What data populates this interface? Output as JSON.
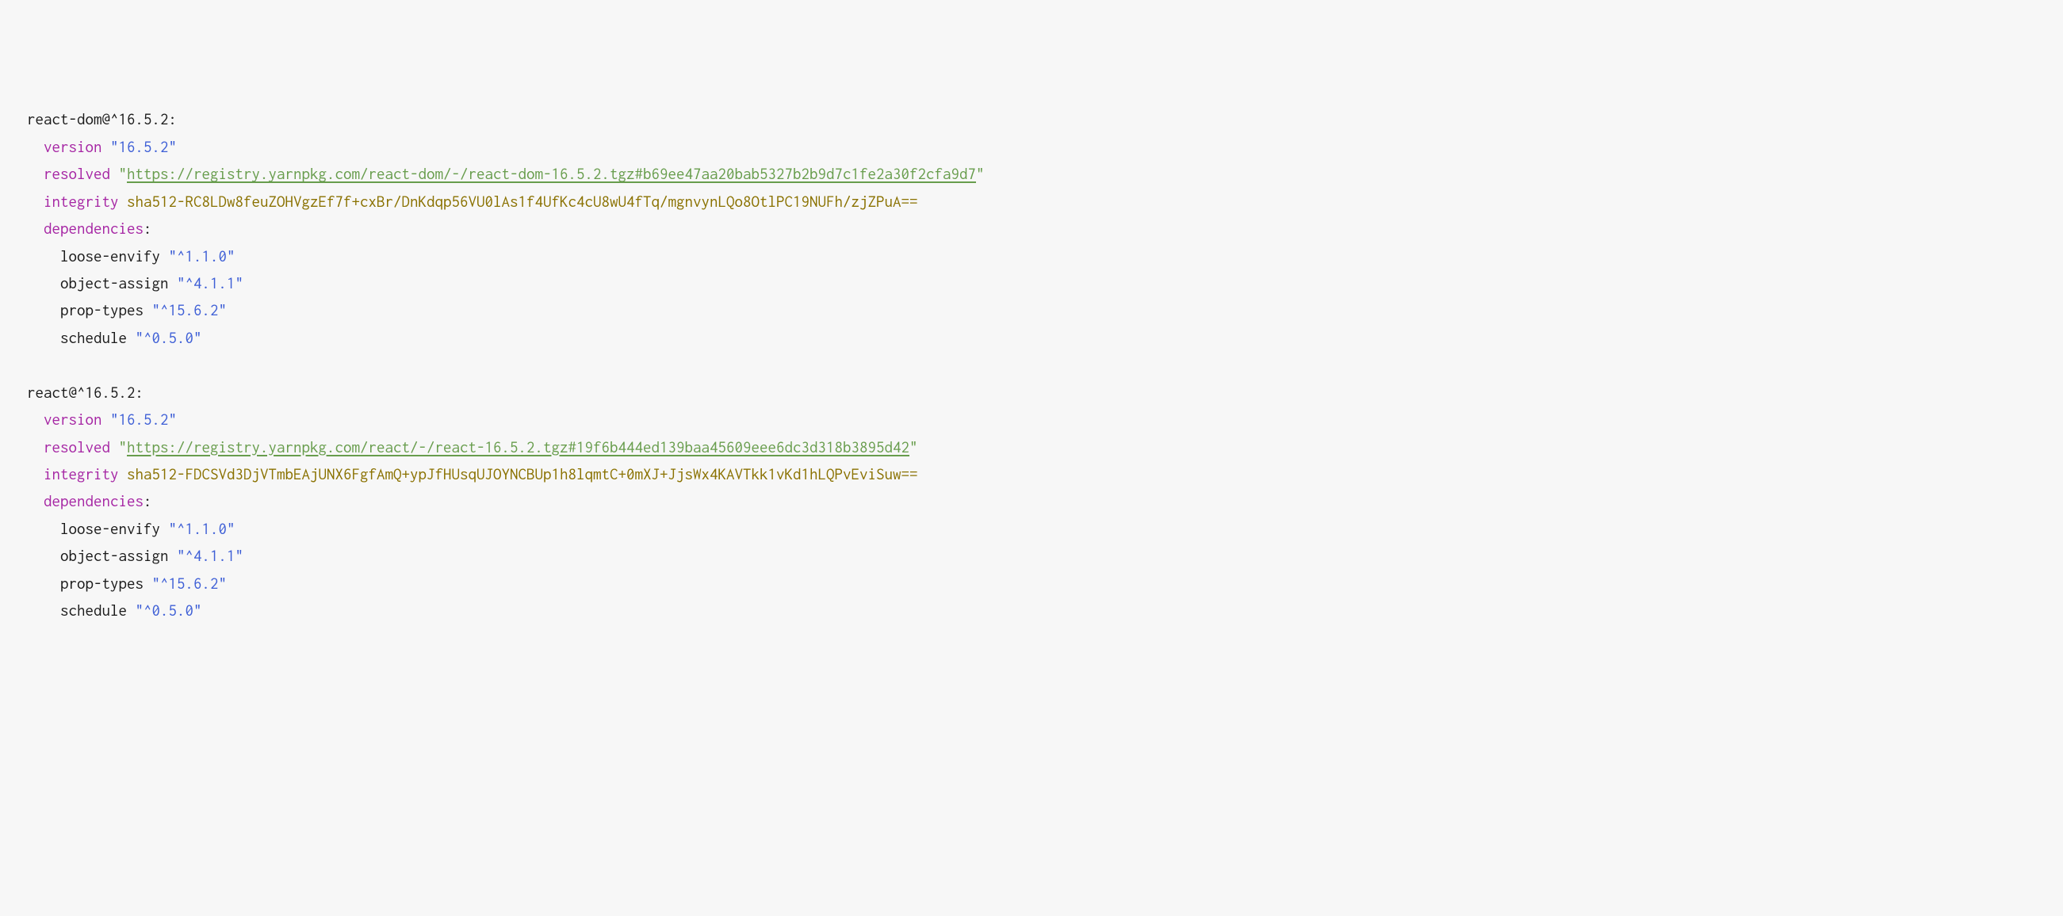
{
  "packages": [
    {
      "header": "react-dom@^16.5.2:",
      "version_key": "version",
      "version_val": "\"16.5.2\"",
      "resolved_key": "resolved",
      "resolved_url": "https://registry.yarnpkg.com/react-dom/-/react-dom-16.5.2.tgz#b69ee47aa20bab5327b2b9d7c1fe2a30f2cfa9d7",
      "integrity_key": "integrity",
      "integrity_val": "sha512-RC8LDw8feuZOHVgzEf7f+cxBr/DnKdqp56VU0lAs1f4UfKc4cU8wU4fTq/mgnvynLQo8OtlPC19NUFh/zjZPuA==",
      "dependencies_key": "dependencies",
      "deps": [
        {
          "name": "loose-envify",
          "ver": "\"^1.1.0\""
        },
        {
          "name": "object-assign",
          "ver": "\"^4.1.1\""
        },
        {
          "name": "prop-types",
          "ver": "\"^15.6.2\""
        },
        {
          "name": "schedule",
          "ver": "\"^0.5.0\""
        }
      ]
    },
    {
      "header": "react@^16.5.2:",
      "version_key": "version",
      "version_val": "\"16.5.2\"",
      "resolved_key": "resolved",
      "resolved_url": "https://registry.yarnpkg.com/react/-/react-16.5.2.tgz#19f6b444ed139baa45609eee6dc3d318b3895d42",
      "integrity_key": "integrity",
      "integrity_val": "sha512-FDCSVd3DjVTmbEAjUNX6FgfAmQ+ypJfHUsqUJOYNCBUp1h8lqmtC+0mXJ+JjsWx4KAVTkk1vKd1hLQPvEviSuw==",
      "dependencies_key": "dependencies",
      "deps": [
        {
          "name": "loose-envify",
          "ver": "\"^1.1.0\""
        },
        {
          "name": "object-assign",
          "ver": "\"^4.1.1\""
        },
        {
          "name": "prop-types",
          "ver": "\"^15.6.2\""
        },
        {
          "name": "schedule",
          "ver": "\"^0.5.0\""
        }
      ]
    }
  ]
}
